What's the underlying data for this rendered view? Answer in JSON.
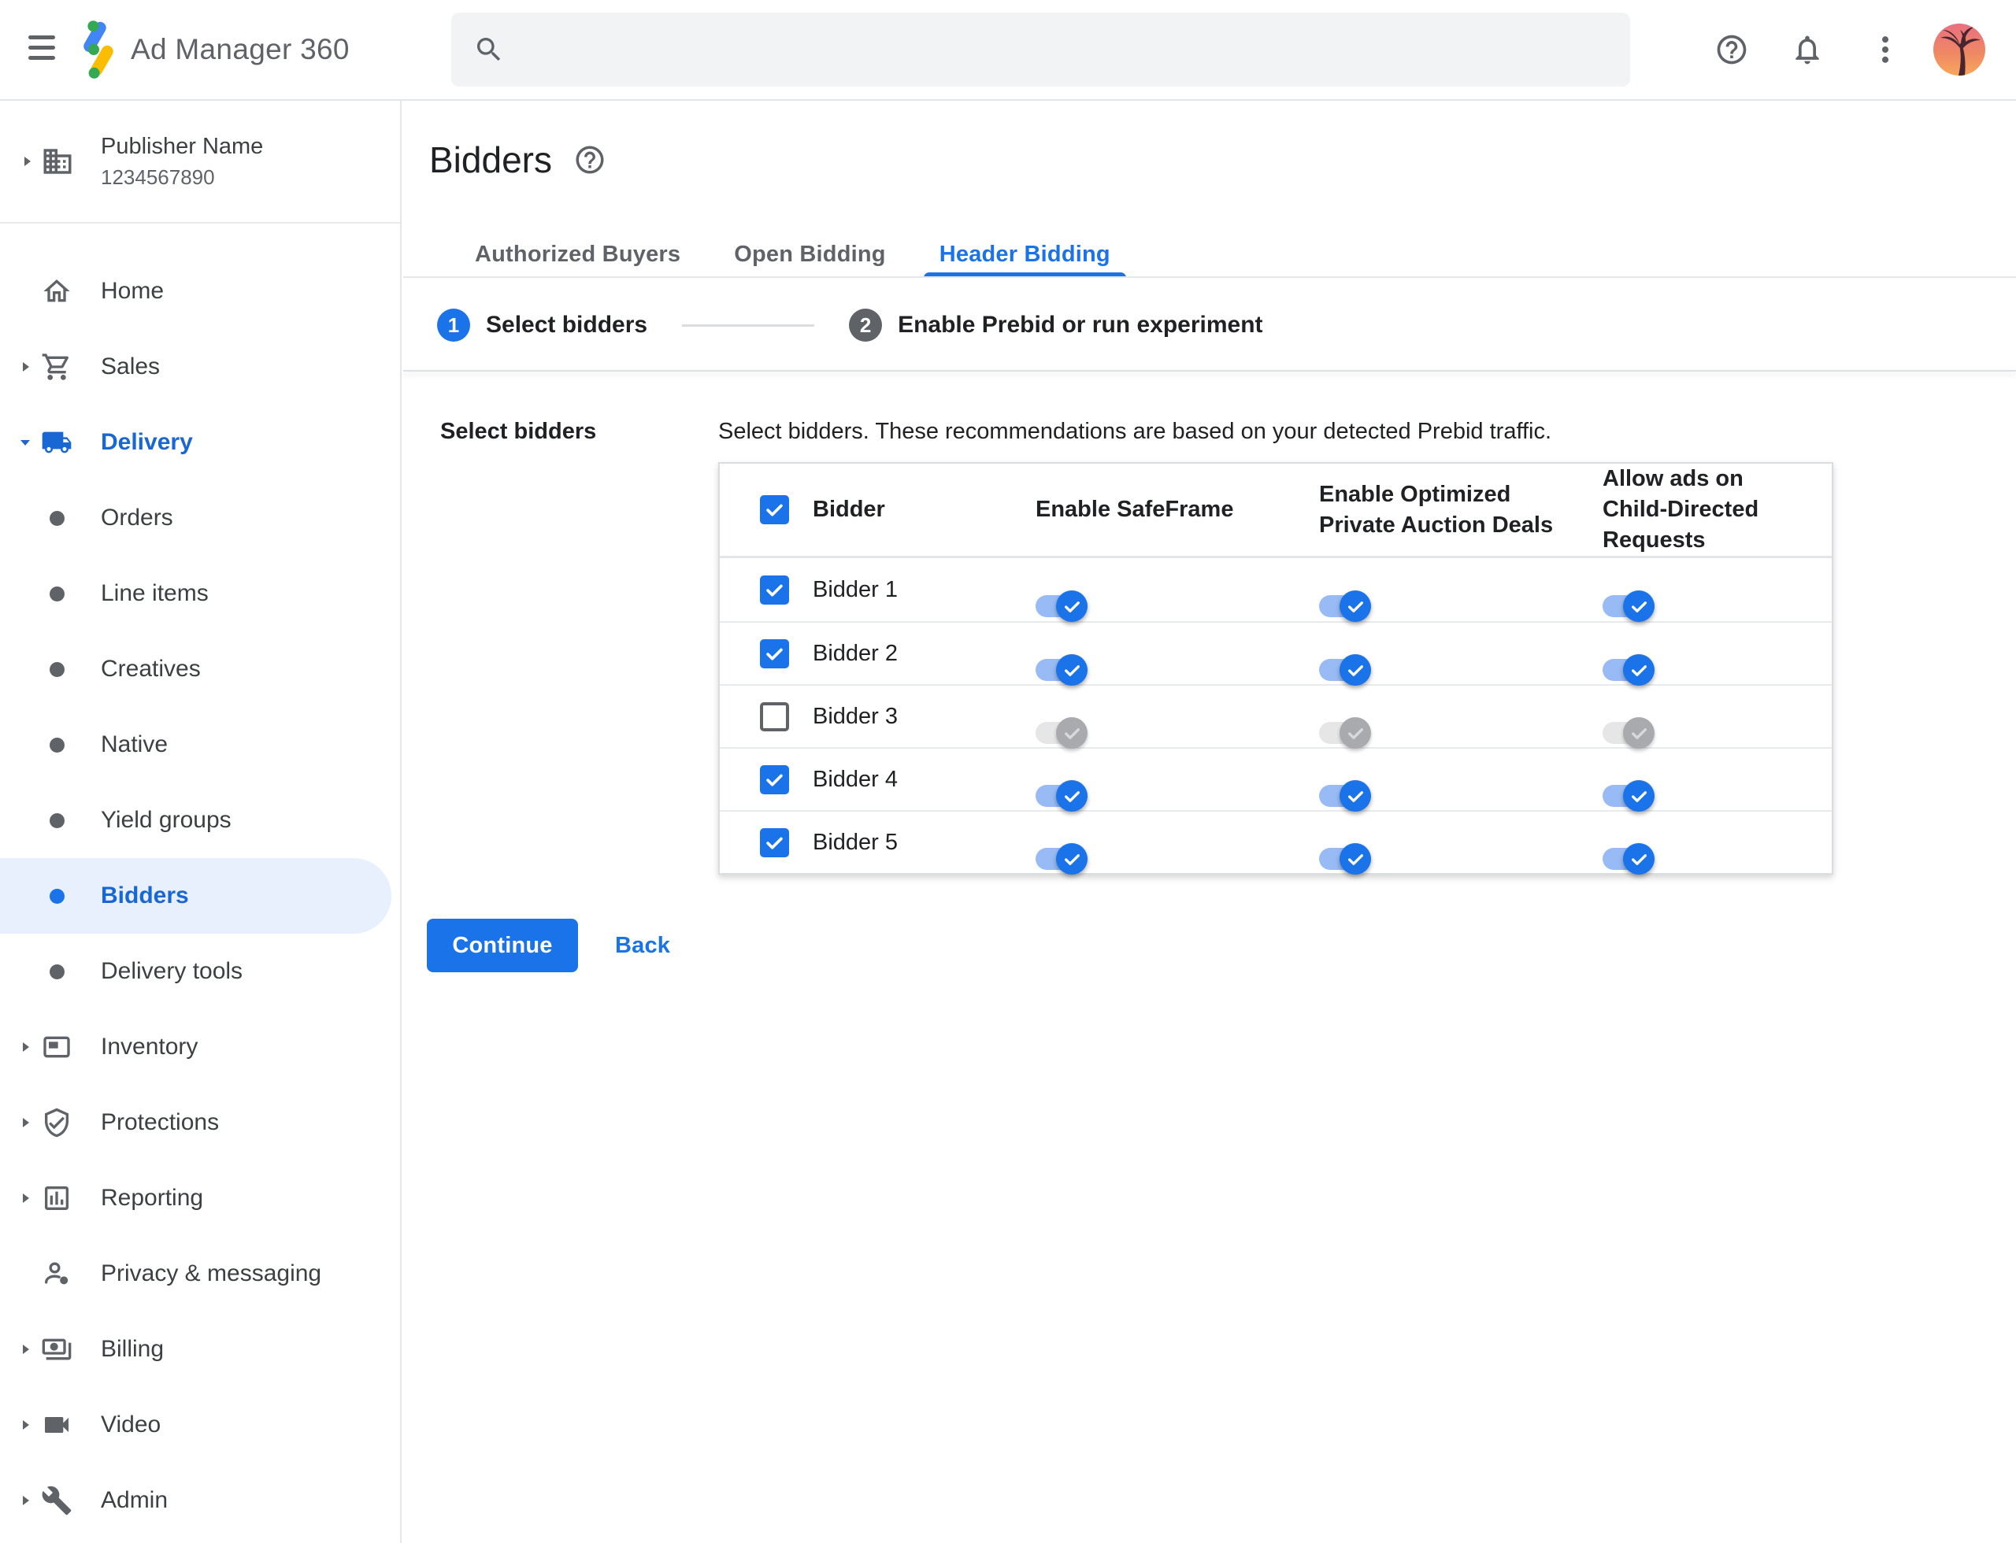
{
  "header": {
    "app_title": "Ad Manager 360",
    "search": {
      "value": ""
    }
  },
  "sidebar": {
    "publisher": {
      "name": "Publisher Name",
      "id": "1234567890"
    },
    "items": [
      {
        "label": "Home",
        "kind": "icon",
        "icon": "home",
        "arrow": null,
        "active": false,
        "selected": false
      },
      {
        "label": "Sales",
        "kind": "icon",
        "icon": "cart",
        "arrow": "right",
        "active": false,
        "selected": false
      },
      {
        "label": "Delivery",
        "kind": "icon",
        "icon": "truck",
        "arrow": "down",
        "active": true,
        "selected": false
      },
      {
        "label": "Orders",
        "kind": "bullet",
        "icon": null,
        "arrow": null,
        "active": false,
        "selected": false
      },
      {
        "label": "Line items",
        "kind": "bullet",
        "icon": null,
        "arrow": null,
        "active": false,
        "selected": false
      },
      {
        "label": "Creatives",
        "kind": "bullet",
        "icon": null,
        "arrow": null,
        "active": false,
        "selected": false
      },
      {
        "label": "Native",
        "kind": "bullet",
        "icon": null,
        "arrow": null,
        "active": false,
        "selected": false
      },
      {
        "label": "Yield groups",
        "kind": "bullet",
        "icon": null,
        "arrow": null,
        "active": false,
        "selected": false
      },
      {
        "label": "Bidders",
        "kind": "bullet",
        "icon": null,
        "arrow": null,
        "active": false,
        "selected": true
      },
      {
        "label": "Delivery tools",
        "kind": "bullet",
        "icon": null,
        "arrow": null,
        "active": false,
        "selected": false
      },
      {
        "label": "Inventory",
        "kind": "icon",
        "icon": "adunit",
        "arrow": "right",
        "active": false,
        "selected": false
      },
      {
        "label": "Protections",
        "kind": "icon",
        "icon": "shield",
        "arrow": "right",
        "active": false,
        "selected": false
      },
      {
        "label": "Reporting",
        "kind": "icon",
        "icon": "chart",
        "arrow": "right",
        "active": false,
        "selected": false
      },
      {
        "label": "Privacy & messaging",
        "kind": "icon",
        "icon": "person",
        "arrow": null,
        "active": false,
        "selected": false
      },
      {
        "label": "Billing",
        "kind": "icon",
        "icon": "payments",
        "arrow": "right",
        "active": false,
        "selected": false
      },
      {
        "label": "Video",
        "kind": "icon",
        "icon": "videocam",
        "arrow": "right",
        "active": false,
        "selected": false
      },
      {
        "label": "Admin",
        "kind": "icon",
        "icon": "wrench",
        "arrow": "right",
        "active": false,
        "selected": false
      }
    ]
  },
  "main": {
    "title": "Bidders",
    "tabs": [
      {
        "label": "Authorized Buyers",
        "active": false
      },
      {
        "label": "Open Bidding",
        "active": false
      },
      {
        "label": "Header Bidding",
        "active": true
      }
    ],
    "steps": [
      {
        "number": "1",
        "label": "Select bidders",
        "active": true
      },
      {
        "number": "2",
        "label": "Enable Prebid or run experiment",
        "active": false
      }
    ],
    "section_label": "Select bidders",
    "description": "Select bidders. These recommendations are based on your detected Prebid traffic.",
    "table": {
      "headers": [
        "Bidder",
        "Enable SafeFrame",
        "Enable Optimized Private Auction Deals",
        "Allow ads on Child-Directed Requests"
      ],
      "select_all_checked": true,
      "rows": [
        {
          "name": "Bidder 1",
          "checked": true,
          "enable_safeframe": true,
          "enable_optimized_deals": true,
          "allow_child_directed": true,
          "toggles_disabled": false
        },
        {
          "name": "Bidder 2",
          "checked": true,
          "enable_safeframe": true,
          "enable_optimized_deals": true,
          "allow_child_directed": true,
          "toggles_disabled": false
        },
        {
          "name": "Bidder 3",
          "checked": false,
          "enable_safeframe": true,
          "enable_optimized_deals": true,
          "allow_child_directed": true,
          "toggles_disabled": true
        },
        {
          "name": "Bidder 4",
          "checked": true,
          "enable_safeframe": true,
          "enable_optimized_deals": true,
          "allow_child_directed": true,
          "toggles_disabled": false
        },
        {
          "name": "Bidder 5",
          "checked": true,
          "enable_safeframe": true,
          "enable_optimized_deals": true,
          "allow_child_directed": true,
          "toggles_disabled": false
        }
      ]
    },
    "buttons": {
      "continue": "Continue",
      "back": "Back"
    }
  },
  "colors": {
    "accent": "#1a73e8",
    "nav_selected_text": "#1967d2",
    "nav_selected_bg": "#e8f0fe",
    "toggle_track_on": "#99bbf5",
    "toggle_thumb_on": "#1a73e8",
    "toggle_track_disabled": "#e6e6e6",
    "toggle_thumb_disabled": "#a8aaad",
    "text_primary": "#202124",
    "text_secondary": "#5f6368",
    "border": "#dadce0"
  }
}
